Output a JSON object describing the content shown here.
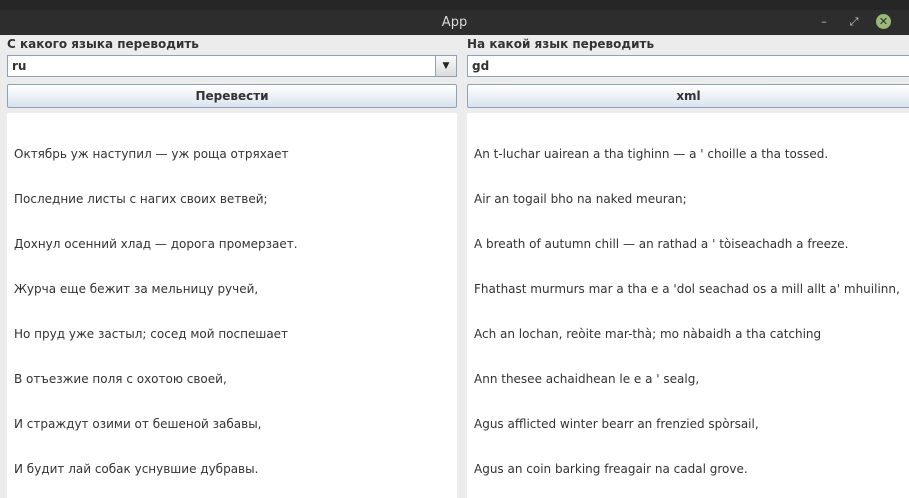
{
  "window": {
    "title": "App",
    "minimize_glyph": "–",
    "maximize_glyph": "⤢",
    "close_glyph": "✕"
  },
  "left": {
    "label": "С какого языка переводить",
    "language": "ru",
    "button": "Перевести",
    "lines": [
      "Октябрь уж наступил — уж роща отряхает",
      "Последние листы с нагих своих ветвей;",
      "Дохнул осенний хлад — дорога промерзает.",
      "Журча еще бежит за мельницу ручей,",
      "Но пруд уже застыл; сосед мой поспешает",
      "В отъезжие поля с охотою своей,",
      "И страждут озими от бешеной забавы,",
      "И будит лай собак уснувшие дубравы."
    ]
  },
  "right": {
    "label": "На какой язык переводить",
    "language": "gd",
    "button": "xml",
    "lines": [
      "An t-luchar uairean a tha tighinn — a ' choille a tha tossed.",
      "Air an togail bho na naked meuran;",
      "A breath of autumn chill — an rathad a ' tòiseachadh a freeze.",
      "Fhathast murmurs mar a tha e a 'dol seachad os a mill allt a' mhuilinn,",
      "Ach an lochan, reòite mar-thà; mo nàbaidh a tha catching",
      "Ann thesee achaidhean le e a ' sealg,",
      "Agus afflicted winter bearr an frenzied spòrsail,",
      "Agus an coin barking freagair na cadal grove."
    ]
  },
  "colors": {
    "titlebar": "#2d2d2d",
    "close_button": "#9ab87a",
    "border_accent": "#8da2b8"
  }
}
